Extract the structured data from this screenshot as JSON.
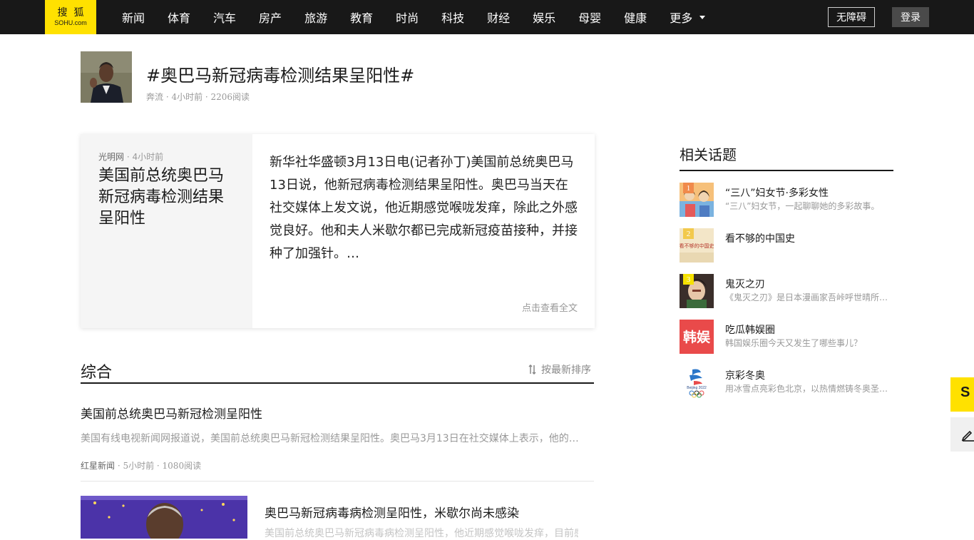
{
  "header": {
    "logo_cn": "搜狐",
    "logo_en": "SOHU.com",
    "nav": [
      "新闻",
      "体育",
      "汽车",
      "房产",
      "旅游",
      "教育",
      "时尚",
      "科技",
      "财经",
      "娱乐",
      "母婴",
      "健康"
    ],
    "more_label": "更多",
    "accessibility_label": "无障碍",
    "login_label": "登录"
  },
  "topic": {
    "title": "#奥巴马新冠病毒检测结果呈阳性#",
    "meta": "奔流 · 4小时前 · 2206阅读"
  },
  "featured": {
    "source": "光明网",
    "time": " · 4小时前",
    "title": "美国前总统奥巴马新冠病毒检测结果呈阳性",
    "body": "新华社华盛顿3月13日电(记者孙丁)美国前总统奥巴马13日说，他新冠病毒检测结果呈阳性。奥巴马当天在社交媒体上发文说，他近期感觉喉咙发痒，除此之外感觉良好。他和夫人米歇尔都已完成新冠疫苗接种，并接种了加强针。…",
    "more_label": "点击查看全文"
  },
  "section": {
    "title": "综合",
    "sort_label": "按最新排序"
  },
  "feed": [
    {
      "title": "美国前总统奥巴马新冠检测呈阳性",
      "desc": "美国有线电视新闻网报道说，美国前总统奥巴马新冠检测结果呈阳性。奥巴马3月13日在社交媒体上表示，他的新冠检测结果呈阳性，他已经接种疫苗和加强针，目前感觉良好。",
      "source": "红星新闻",
      "meta": " · 5小时前 · 1080阅读"
    },
    {
      "title": "奥巴马新冠病毒病检测呈阳性，米歇尔尚未感染",
      "desc": "美国前总统奥巴马新冠病毒病检测呈阳性，他近期感觉喉咙发痒，目前感觉良好。"
    }
  ],
  "sidebar": {
    "title": "相关话题",
    "items": [
      {
        "rank": "1",
        "name": "“三八”妇女节·多彩女性",
        "desc": "“三八”妇女节，一起聊聊她的多彩故事。"
      },
      {
        "rank": "2",
        "name": "看不够的中国史",
        "desc": ""
      },
      {
        "rank": "3",
        "name": "鬼灭之刃",
        "desc": "《鬼灭之刃》是日本漫画家吾峠呼世晴所著的少年漫画作品。"
      },
      {
        "rank": "",
        "name": "吃瓜韩娱圈",
        "desc": "韩国娱乐圈今天又发生了哪些事儿？"
      },
      {
        "rank": "",
        "name": "京彩冬奥",
        "desc": "用冰雪点亮彩色北京，以热情燃铸冬奥圣火。"
      }
    ]
  },
  "thumb_text": {
    "history": "看不够的中国史",
    "korean": "韩娱",
    "beijing": "Beijing 2022"
  },
  "float": {
    "logo_letter": "S"
  },
  "colors": {
    "brand_yellow": "#ffe100",
    "nav_bg": "#181818",
    "rank_1": "#f08a4b",
    "rank_2": "#f2c94c",
    "rank_3": "#f5e100"
  }
}
